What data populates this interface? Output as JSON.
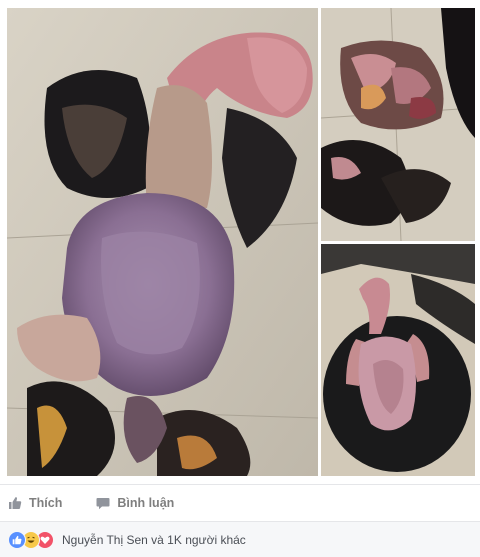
{
  "post": {
    "photos": [
      {
        "name": "main-photo"
      },
      {
        "name": "top-right-photo"
      },
      {
        "name": "bottom-right-photo"
      }
    ]
  },
  "actions": {
    "like_label": "Thích",
    "comment_label": "Bình luận"
  },
  "reactions": {
    "icons": [
      "like-icon",
      "haha-icon",
      "love-icon"
    ],
    "summary": "Nguyễn Thị Sen và 1K người khác"
  },
  "colors": {
    "like_blue": "#5890ff",
    "haha_yellow": "#f7c94a",
    "love_red": "#f25268",
    "action_gray": "#7f7f7f",
    "footer_bg": "#f6f7f9"
  }
}
